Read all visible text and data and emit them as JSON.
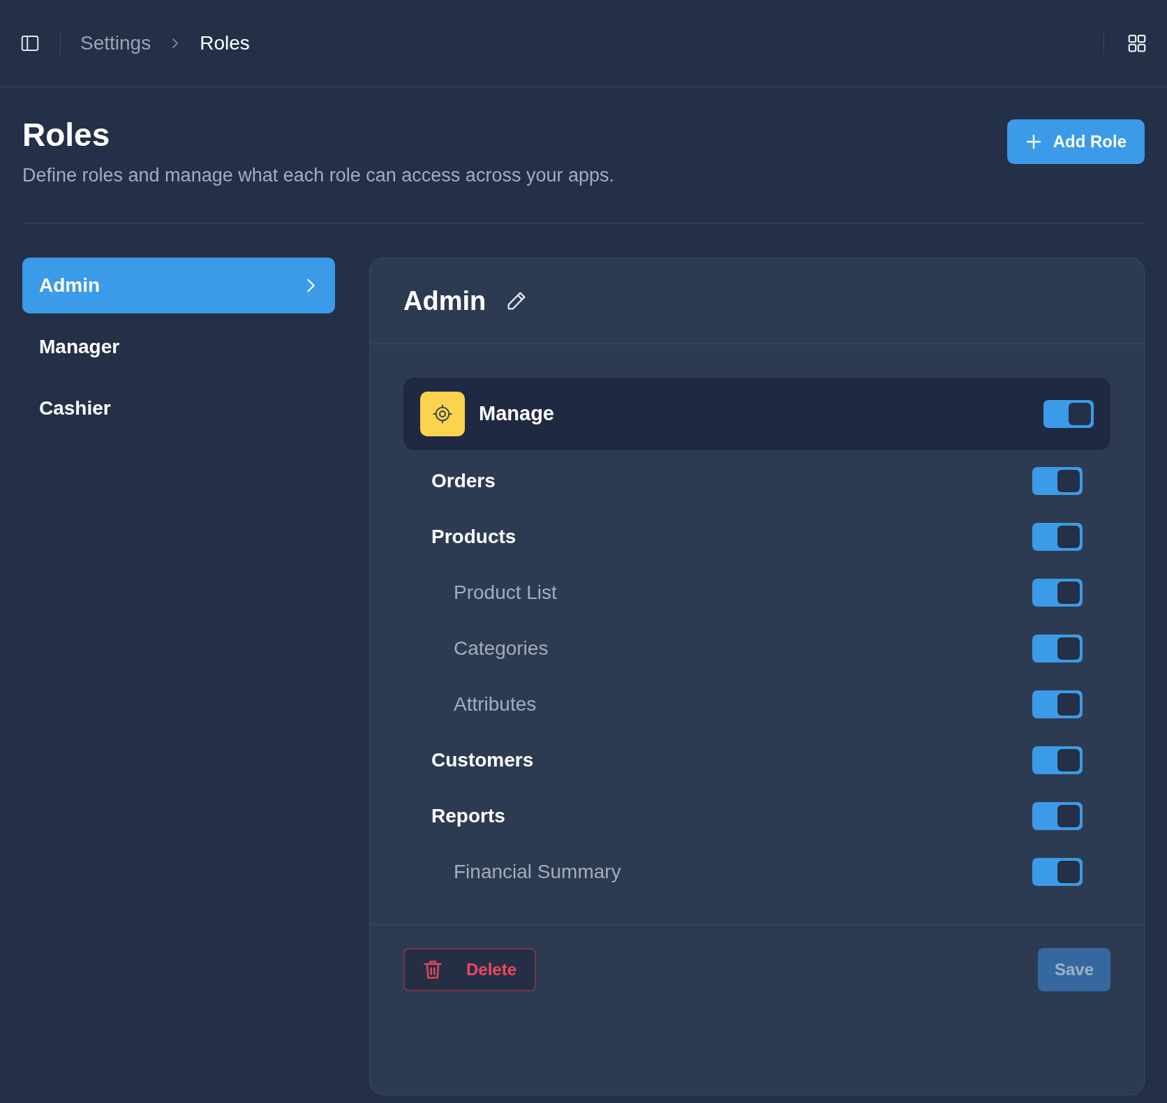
{
  "breadcrumb": [
    {
      "label": "Settings",
      "current": false
    },
    {
      "label": "Roles",
      "current": true
    }
  ],
  "page": {
    "title": "Roles",
    "subtitle": "Define roles and manage what each role can access across your apps.",
    "add_button": "Add Role"
  },
  "roles": [
    {
      "label": "Admin",
      "selected": true
    },
    {
      "label": "Manager",
      "selected": false
    },
    {
      "label": "Cashier",
      "selected": false
    }
  ],
  "panel": {
    "title": "Admin",
    "app": {
      "label": "Manage",
      "on": true
    },
    "permissions": [
      {
        "label": "Orders",
        "on": true
      },
      {
        "label": "Products",
        "on": true,
        "children": [
          {
            "label": "Product List",
            "on": true
          },
          {
            "label": "Categories",
            "on": true
          },
          {
            "label": "Attributes",
            "on": true
          }
        ]
      },
      {
        "label": "Customers",
        "on": true
      },
      {
        "label": "Reports",
        "on": true,
        "children": [
          {
            "label": "Financial Summary",
            "on": true
          }
        ]
      }
    ],
    "delete_button": "Delete",
    "save_button": "Save"
  }
}
